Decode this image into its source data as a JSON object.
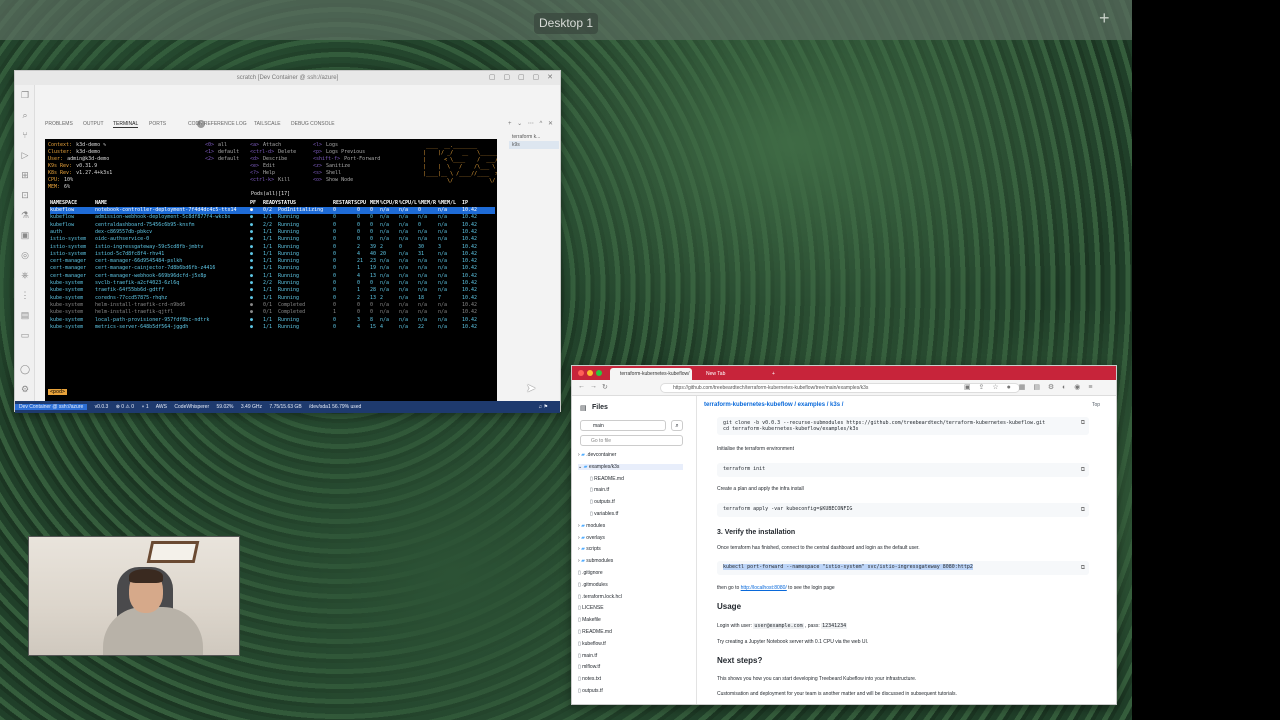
{
  "desktop": {
    "label": "Desktop 1",
    "add_icon": "+"
  },
  "vscode": {
    "title": "scratch [Dev Container @ ssh://azure]",
    "panel_tabs": [
      "PROBLEMS",
      "OUTPUT",
      "TERMINAL",
      "PORTS",
      "CODE REFERENCE LOG",
      "TAILSCALE",
      "DEBUG CONSOLE"
    ],
    "ports_count": "2",
    "terminal_list": [
      "terraform k...",
      "k9s"
    ],
    "k9s": {
      "info": [
        {
          "label": "Context:",
          "value": "k3d-demo ✎"
        },
        {
          "label": "Cluster:",
          "value": "k3d-demo"
        },
        {
          "label": "User:",
          "value": "admin@k3d-demo"
        },
        {
          "label": "K9s Rev:",
          "value": "v0.31.9"
        },
        {
          "label": "K8s Rev:",
          "value": "v1.27.4+k3s1"
        },
        {
          "label": "CPU:",
          "value": "10%"
        },
        {
          "label": "MEM:",
          "value": "6%"
        }
      ],
      "shortcuts_col1": [
        {
          "key": "<0>",
          "text": "all"
        },
        {
          "key": "<1>",
          "text": "default"
        },
        {
          "key": "<2>",
          "text": "default"
        }
      ],
      "shortcuts_col2": [
        {
          "key": "<a>",
          "text": "Attach"
        },
        {
          "key": "<ctrl-d>",
          "text": "Delete"
        },
        {
          "key": "<d>",
          "text": "Describe"
        },
        {
          "key": "<e>",
          "text": "Edit"
        },
        {
          "key": "<?>",
          "text": "Help"
        },
        {
          "key": "<ctrl-k>",
          "text": "Kill"
        }
      ],
      "shortcuts_col3": [
        {
          "key": "<l>",
          "text": "Logs"
        },
        {
          "key": "<p>",
          "text": "Logs Previous"
        },
        {
          "key": "<shift-f>",
          "text": "Port-Forward"
        },
        {
          "key": "<z>",
          "text": "Sanitize"
        },
        {
          "key": "<s>",
          "text": "Shell"
        },
        {
          "key": "<o>",
          "text": "Show Node"
        }
      ],
      "pods_title": "Pods(all)[17]",
      "headers": [
        "NAMESPACE",
        "NAME",
        "PF",
        "READY",
        "STATUS",
        "RESTARTS",
        "CPU",
        "MEM",
        "%CPU/R",
        "%CPU/L",
        "%MEM/R",
        "%MEM/L",
        "IP"
      ],
      "rows": [
        {
          "ns": "kubeflow",
          "name": "notebook-controller-deployment-7f4d4dc4c5-ttx14",
          "pf": "●",
          "ready": "0/2",
          "status": "PodInitializing",
          "restarts": "0",
          "cpu": "0",
          "mem": "0",
          "cr": "n/a",
          "cl": "n/a",
          "mr": "0",
          "ml": "n/a",
          "ip": "10.42"
        },
        {
          "ns": "kubeflow",
          "name": "admission-webhook-deployment-5c8df877f4-wkcbs",
          "pf": "●",
          "ready": "1/1",
          "status": "Running",
          "restarts": "0",
          "cpu": "0",
          "mem": "0",
          "cr": "n/a",
          "cl": "n/a",
          "mr": "n/a",
          "ml": "n/a",
          "ip": "10.42"
        },
        {
          "ns": "kubeflow",
          "name": "centraldashboard-75456c6b95-knsfm",
          "pf": "●",
          "ready": "2/2",
          "status": "Running",
          "restarts": "0",
          "cpu": "0",
          "mem": "0",
          "cr": "n/a",
          "cl": "n/a",
          "mr": "0",
          "ml": "n/a",
          "ip": "10.42"
        },
        {
          "ns": "auth",
          "name": "dex-c869557db-pbkcv",
          "pf": "●",
          "ready": "1/1",
          "status": "Running",
          "restarts": "0",
          "cpu": "0",
          "mem": "0",
          "cr": "n/a",
          "cl": "n/a",
          "mr": "n/a",
          "ml": "n/a",
          "ip": "10.42"
        },
        {
          "ns": "istio-system",
          "name": "oidc-authservice-0",
          "pf": "●",
          "ready": "1/1",
          "status": "Running",
          "restarts": "0",
          "cpu": "0",
          "mem": "0",
          "cr": "n/a",
          "cl": "n/a",
          "mr": "n/a",
          "ml": "n/a",
          "ip": "10.42"
        },
        {
          "ns": "istio-system",
          "name": "istio-ingressgateway-59c5cd8fb-jmbtv",
          "pf": "●",
          "ready": "1/1",
          "status": "Running",
          "restarts": "0",
          "cpu": "2",
          "mem": "39",
          "cr": "2",
          "cl": "0",
          "mr": "30",
          "ml": "3",
          "ip": "10.42"
        },
        {
          "ns": "istio-system",
          "name": "istiod-5c7d8fc8f4-rhv41",
          "pf": "●",
          "ready": "1/1",
          "status": "Running",
          "restarts": "0",
          "cpu": "4",
          "mem": "40",
          "cr": "20",
          "cl": "n/a",
          "mr": "31",
          "ml": "n/a",
          "ip": "10.42"
        },
        {
          "ns": "cert-manager",
          "name": "cert-manager-66d9545484-pslkh",
          "pf": "●",
          "ready": "1/1",
          "status": "Running",
          "restarts": "0",
          "cpu": "21",
          "mem": "23",
          "cr": "n/a",
          "cl": "n/a",
          "mr": "n/a",
          "ml": "n/a",
          "ip": "10.42"
        },
        {
          "ns": "cert-manager",
          "name": "cert-manager-cainjector-7d8b6bd6fb-z4416",
          "pf": "●",
          "ready": "1/1",
          "status": "Running",
          "restarts": "0",
          "cpu": "1",
          "mem": "19",
          "cr": "n/a",
          "cl": "n/a",
          "mr": "n/a",
          "ml": "n/a",
          "ip": "10.42"
        },
        {
          "ns": "cert-manager",
          "name": "cert-manager-webhook-669b96dcfd-j5x8p",
          "pf": "●",
          "ready": "1/1",
          "status": "Running",
          "restarts": "0",
          "cpu": "4",
          "mem": "13",
          "cr": "n/a",
          "cl": "n/a",
          "mr": "n/a",
          "ml": "n/a",
          "ip": "10.42"
        },
        {
          "ns": "kube-system",
          "name": "svclb-traefik-a2cf4023-6zl6q",
          "pf": "●",
          "ready": "2/2",
          "status": "Running",
          "restarts": "0",
          "cpu": "0",
          "mem": "0",
          "cr": "n/a",
          "cl": "n/a",
          "mr": "n/a",
          "ml": "n/a",
          "ip": "10.42"
        },
        {
          "ns": "kube-system",
          "name": "traefik-64f55bb6d-gdtff",
          "pf": "●",
          "ready": "1/1",
          "status": "Running",
          "restarts": "0",
          "cpu": "1",
          "mem": "28",
          "cr": "n/a",
          "cl": "n/a",
          "mr": "n/a",
          "ml": "n/a",
          "ip": "10.42"
        },
        {
          "ns": "kube-system",
          "name": "coredns-77ccd57875-rhqhz",
          "pf": "●",
          "ready": "1/1",
          "status": "Running",
          "restarts": "0",
          "cpu": "2",
          "mem": "13",
          "cr": "2",
          "cl": "n/a",
          "mr": "18",
          "ml": "7",
          "ip": "10.42"
        },
        {
          "ns": "kube-system",
          "name": "helm-install-traefik-crd-n9bd6",
          "pf": "●",
          "ready": "0/1",
          "status": "Completed",
          "restarts": "0",
          "cpu": "0",
          "mem": "0",
          "cr": "n/a",
          "cl": "n/a",
          "mr": "n/a",
          "ml": "n/a",
          "ip": "10.42"
        },
        {
          "ns": "kube-system",
          "name": "helm-install-traefik-qjtfl",
          "pf": "●",
          "ready": "0/1",
          "status": "Completed",
          "restarts": "1",
          "cpu": "0",
          "mem": "0",
          "cr": "n/a",
          "cl": "n/a",
          "mr": "n/a",
          "ml": "n/a",
          "ip": "10.42"
        },
        {
          "ns": "kube-system",
          "name": "local-path-provisioner-957fdf8bc-ndtrk",
          "pf": "●",
          "ready": "1/1",
          "status": "Running",
          "restarts": "0",
          "cpu": "3",
          "mem": "8",
          "cr": "n/a",
          "cl": "n/a",
          "mr": "n/a",
          "ml": "n/a",
          "ip": "10.42"
        },
        {
          "ns": "kube-system",
          "name": "metrics-server-648b5df564-jggdh",
          "pf": "●",
          "ready": "1/1",
          "status": "Running",
          "restarts": "0",
          "cpu": "4",
          "mem": "15",
          "cr": "4",
          "cl": "n/a",
          "mr": "22",
          "ml": "n/a",
          "ip": "10.42"
        }
      ],
      "cmd_tag": "<pod>"
    },
    "status_bar": [
      "Dev Container @ ssh://azure",
      "v0.0.3",
      "⊗ 0 ⚠ 0",
      "⑂ 1",
      "AWS",
      "CodeWhisperer",
      "59.02%",
      "3.49 GHz",
      "7.75/15.63 GB",
      "/dev/sda1 56.79% used"
    ]
  },
  "browser": {
    "tabs": [
      "terraform-kubernetes-kubeflow/",
      "New Tab"
    ],
    "url": "https://github.com/treebeardtech/terraform-kubernetes-kubeflow/tree/main/examples/k3s",
    "sidebar": {
      "title": "Files",
      "branch": "main",
      "goto_placeholder": "Go to file",
      "items": [
        {
          "label": ".devcontainer",
          "type": "folder",
          "depth": 0
        },
        {
          "label": "examples/k3s",
          "type": "folder",
          "depth": 0,
          "selected": true
        },
        {
          "label": "README.md",
          "type": "file",
          "depth": 1
        },
        {
          "label": "main.tf",
          "type": "file",
          "depth": 1
        },
        {
          "label": "outputs.tf",
          "type": "file",
          "depth": 1
        },
        {
          "label": "variables.tf",
          "type": "file",
          "depth": 1
        },
        {
          "label": "modules",
          "type": "folder",
          "depth": 0
        },
        {
          "label": "overlays",
          "type": "folder",
          "depth": 0
        },
        {
          "label": "scripts",
          "type": "folder",
          "depth": 0
        },
        {
          "label": "submodules",
          "type": "folder",
          "depth": 0
        },
        {
          "label": ".gitignore",
          "type": "file",
          "depth": 0
        },
        {
          "label": ".gitmodules",
          "type": "file",
          "depth": 0
        },
        {
          "label": ".terraform.lock.hcl",
          "type": "file",
          "depth": 0
        },
        {
          "label": "LICENSE",
          "type": "file",
          "depth": 0
        },
        {
          "label": "Makefile",
          "type": "file",
          "depth": 0
        },
        {
          "label": "README.md",
          "type": "file",
          "depth": 0
        },
        {
          "label": "kubeflow.tf",
          "type": "file",
          "depth": 0
        },
        {
          "label": "main.tf",
          "type": "file",
          "depth": 0
        },
        {
          "label": "mlflow.tf",
          "type": "file",
          "depth": 0
        },
        {
          "label": "notes.txt",
          "type": "file",
          "depth": 0
        },
        {
          "label": "outputs.tf",
          "type": "file",
          "depth": 0
        }
      ]
    },
    "content": {
      "breadcrumb": "terraform-kubernetes-kubeflow / examples / k3s /",
      "top": "Top",
      "code1": "git clone -b v0.0.3 --recurse-submodules https://github.com/treebeardtech/terraform-kubernetes-kubeflow.git\ncd terraform-kubernetes-kubeflow/examples/k3s",
      "p1": "Initialise the terraform environment",
      "code2": "terraform init",
      "p2": "Create a plan and apply the infra install",
      "code3": "terraform apply -var kubeconfig=$KUBECONFIG",
      "h3_verify": "3. Verify the installation",
      "p3": "Once terraform has finished, connect to the central dashboard and login as the default user.",
      "code4": "kubectl port-forward --namespace \"istio-system\" svc/istio-ingressgateway 8080:http2",
      "p4_pre": "then go to ",
      "p4_link": "http://localhost:8080/",
      "p4_post": " to see the login page",
      "h2_usage": "Usage",
      "p5_pre": "Login with user: ",
      "p5_user": "user@example.com",
      "p5_mid": " , pass: ",
      "p5_pass": "12341234",
      "p6": "Try creating a Jupyter Notebook server with 0.1 CPU via the web UI.",
      "h2_next": "Next steps?",
      "p7": "This shows you how you can start developing Treebeard Kubeflow into your infrastructure.",
      "p8": "Customisation and deployment for your team is another matter and will be discussed in subsequent tutorials."
    }
  }
}
